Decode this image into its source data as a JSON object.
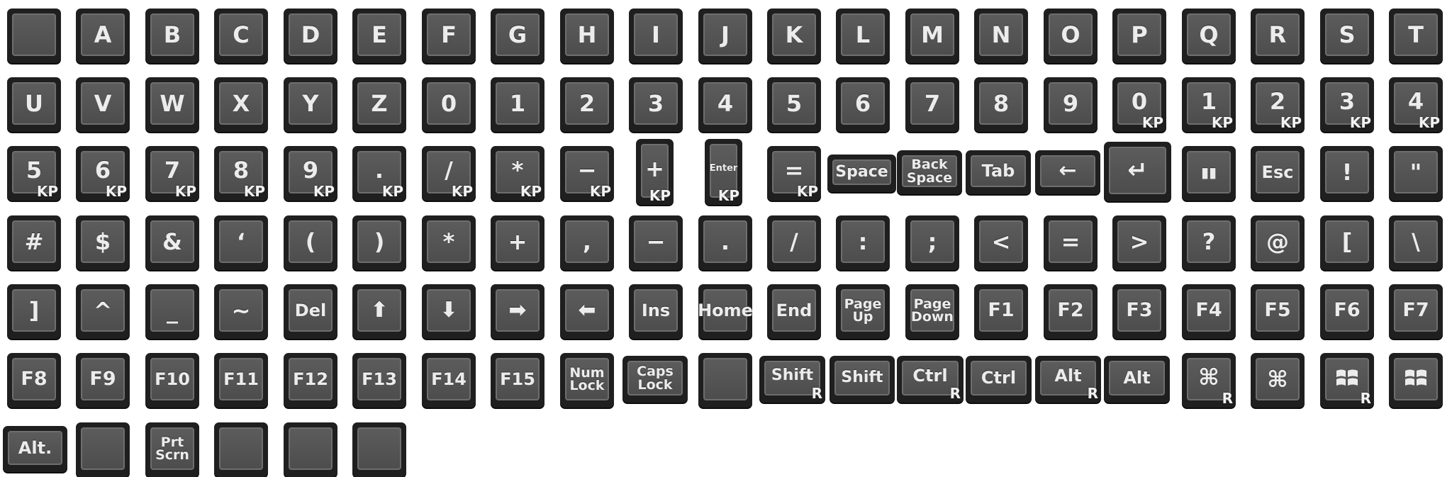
{
  "rows": [
    [
      {
        "label": "",
        "icon": "blank-key"
      },
      {
        "label": "A"
      },
      {
        "label": "B"
      },
      {
        "label": "C"
      },
      {
        "label": "D"
      },
      {
        "label": "E"
      },
      {
        "label": "F"
      },
      {
        "label": "G"
      },
      {
        "label": "H"
      },
      {
        "label": "I"
      },
      {
        "label": "J"
      },
      {
        "label": "K"
      },
      {
        "label": "L"
      },
      {
        "label": "M"
      },
      {
        "label": "N"
      },
      {
        "label": "O"
      },
      {
        "label": "P"
      },
      {
        "label": "Q"
      },
      {
        "label": "R"
      },
      {
        "label": "S"
      },
      {
        "label": "T"
      }
    ],
    [
      {
        "label": "U"
      },
      {
        "label": "V"
      },
      {
        "label": "W"
      },
      {
        "label": "X"
      },
      {
        "label": "Y"
      },
      {
        "label": "Z"
      },
      {
        "label": "0"
      },
      {
        "label": "1"
      },
      {
        "label": "2"
      },
      {
        "label": "3"
      },
      {
        "label": "4"
      },
      {
        "label": "5"
      },
      {
        "label": "6"
      },
      {
        "label": "7"
      },
      {
        "label": "8"
      },
      {
        "label": "9"
      },
      {
        "label": "0",
        "sub": "KP"
      },
      {
        "label": "1",
        "sub": "KP"
      },
      {
        "label": "2",
        "sub": "KP"
      },
      {
        "label": "3",
        "sub": "KP"
      },
      {
        "label": "4",
        "sub": "KP"
      }
    ],
    [
      {
        "label": "5",
        "sub": "KP"
      },
      {
        "label": "6",
        "sub": "KP"
      },
      {
        "label": "7",
        "sub": "KP"
      },
      {
        "label": "8",
        "sub": "KP"
      },
      {
        "label": "9",
        "sub": "KP"
      },
      {
        "label": ".",
        "sub": "KP"
      },
      {
        "label": "/",
        "sub": "KP"
      },
      {
        "label": "*",
        "sub": "KP"
      },
      {
        "label": "−",
        "sub": "KP"
      },
      {
        "label": "+",
        "sub": "KP",
        "shape": "tall"
      },
      {
        "label": "Enter",
        "sub": "KP",
        "shape": "tall"
      },
      {
        "label": "=",
        "sub": "KP"
      },
      {
        "label": "Space",
        "shape": "wide"
      },
      {
        "label": "Back\nSpace",
        "shape": "wide"
      },
      {
        "label": "Tab",
        "shape": "wide"
      },
      {
        "label": "←",
        "shape": "wide",
        "icon": "backspace-arrow-icon"
      },
      {
        "label": "↵",
        "shape": "wide",
        "icon": "return-icon"
      },
      {
        "label": "▮▮",
        "icon": "pause-icon"
      },
      {
        "label": "Esc"
      },
      {
        "label": "!"
      },
      {
        "label": "\""
      }
    ],
    [
      {
        "label": "#"
      },
      {
        "label": "$"
      },
      {
        "label": "&"
      },
      {
        "label": "‘"
      },
      {
        "label": "("
      },
      {
        "label": ")"
      },
      {
        "label": "*"
      },
      {
        "label": "+"
      },
      {
        "label": ","
      },
      {
        "label": "−"
      },
      {
        "label": "."
      },
      {
        "label": "/"
      },
      {
        "label": ":"
      },
      {
        "label": ";"
      },
      {
        "label": "<"
      },
      {
        "label": "="
      },
      {
        "label": ">"
      },
      {
        "label": "?"
      },
      {
        "label": "@"
      },
      {
        "label": "["
      },
      {
        "label": "\\"
      }
    ],
    [
      {
        "label": "]"
      },
      {
        "label": "^"
      },
      {
        "label": "_"
      },
      {
        "label": "~"
      },
      {
        "label": "Del"
      },
      {
        "label": "⬆",
        "icon": "arrow-up-icon"
      },
      {
        "label": "⬇",
        "icon": "arrow-down-icon"
      },
      {
        "label": "➡",
        "icon": "arrow-right-icon"
      },
      {
        "label": "⬅",
        "icon": "arrow-left-icon"
      },
      {
        "label": "Ins"
      },
      {
        "label": "Home"
      },
      {
        "label": "End"
      },
      {
        "label": "Page\nUp"
      },
      {
        "label": "Page\nDown"
      },
      {
        "label": "F1"
      },
      {
        "label": "F2"
      },
      {
        "label": "F3"
      },
      {
        "label": "F4"
      },
      {
        "label": "F5"
      },
      {
        "label": "F6"
      },
      {
        "label": "F7"
      }
    ],
    [
      {
        "label": "F8"
      },
      {
        "label": "F9"
      },
      {
        "label": "F10"
      },
      {
        "label": "F11"
      },
      {
        "label": "F12"
      },
      {
        "label": "F13"
      },
      {
        "label": "F14"
      },
      {
        "label": "F15"
      },
      {
        "label": "Num\nLock"
      },
      {
        "label": "Caps\nLock",
        "shape": "wide"
      },
      {
        "label": "",
        "icon": "blank-key"
      },
      {
        "label": "Shift",
        "sub": "R",
        "shape": "wide"
      },
      {
        "label": "Shift",
        "shape": "wide"
      },
      {
        "label": "Ctrl",
        "sub": "R",
        "shape": "wide"
      },
      {
        "label": "Ctrl",
        "shape": "wide"
      },
      {
        "label": "Alt",
        "sub": "R",
        "shape": "wide"
      },
      {
        "label": "Alt",
        "shape": "wide"
      },
      {
        "label": "⌘",
        "sub": "R",
        "icon": "command-icon"
      },
      {
        "label": "⌘",
        "icon": "command-icon"
      },
      {
        "label": "",
        "sub": "R",
        "icon": "windows-logo-icon"
      },
      {
        "label": "",
        "icon": "windows-logo-icon"
      }
    ],
    [
      {
        "label": "Alt.",
        "shape": "wide"
      },
      {
        "label": "",
        "icon": "blank-key"
      },
      {
        "label": "Prt\nScrn"
      },
      {
        "label": "",
        "icon": "blank-key"
      },
      {
        "label": "",
        "icon": "blank-key"
      },
      {
        "label": "",
        "icon": "blank-key"
      }
    ]
  ],
  "colors": {
    "key_border": "#1f1f1f",
    "key_face": "#555555",
    "label": "#ececec"
  }
}
